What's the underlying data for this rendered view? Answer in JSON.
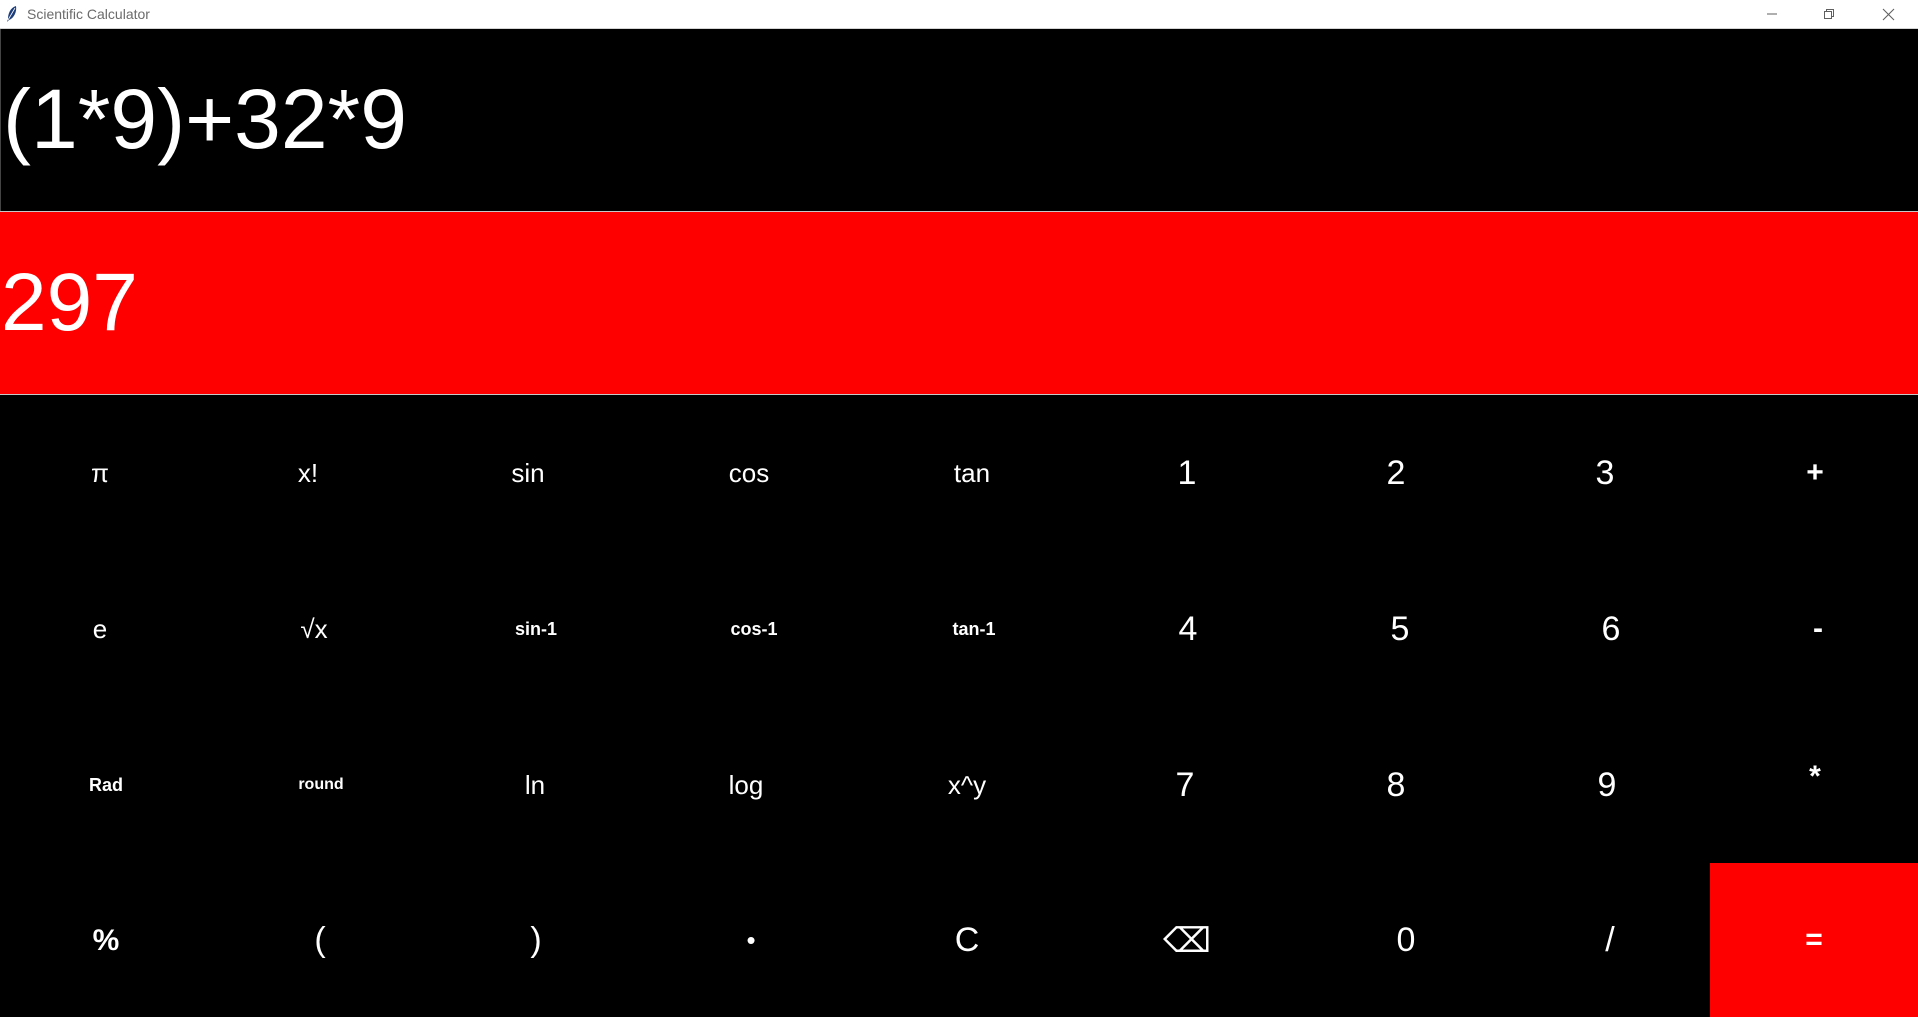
{
  "window": {
    "title": "Scientific Calculator",
    "minimize_glyph": "—",
    "maximize_glyph": "❐",
    "close_glyph": "✕"
  },
  "display": {
    "expression": "(1*9)+32*9",
    "result": "297"
  },
  "colors": {
    "background": "#000000",
    "accent": "#ff0000",
    "text": "#ffffff"
  },
  "keys": {
    "row1": [
      "π",
      "x!",
      "sin",
      "cos",
      "tan",
      "1",
      "2",
      "3",
      "+"
    ],
    "row2": [
      "e",
      "√x",
      "sin-1",
      "cos-1",
      "tan-1",
      "4",
      "5",
      "6",
      "-"
    ],
    "row3": [
      "Rad",
      "round",
      "ln",
      "log",
      "x^y",
      "7",
      "8",
      "9",
      "*"
    ],
    "row4": [
      "%",
      "(",
      ")",
      "•",
      "C",
      "⌫",
      "0",
      "/",
      "="
    ]
  }
}
